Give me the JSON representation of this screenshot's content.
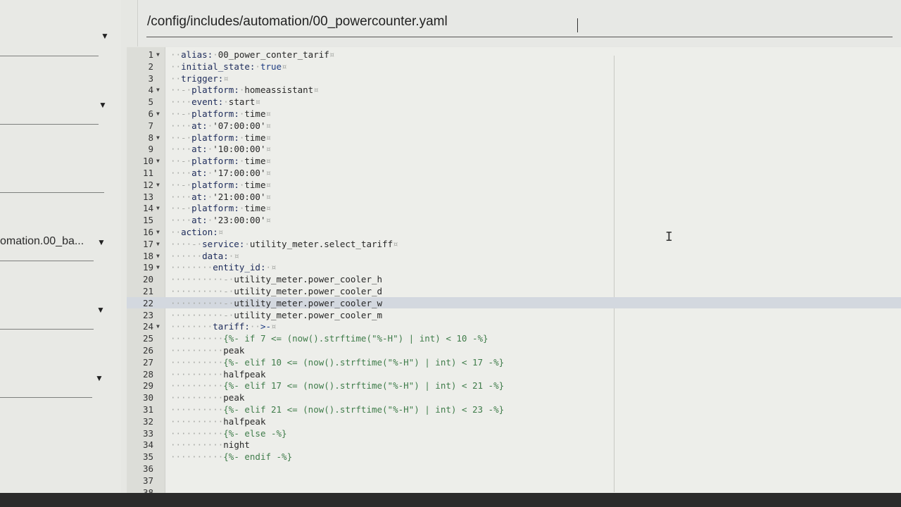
{
  "sidebar": {
    "visible_text": "omation.00_ba..."
  },
  "file_path": "/config/includes/automation/00_powercounter.yaml",
  "editor": {
    "active_line": 22,
    "lines": [
      {
        "n": "1",
        "fold": true,
        "indent": "··",
        "parts": [
          [
            "k",
            "alias:"
          ],
          [
            "ws",
            "·"
          ],
          [
            "v",
            "00_power_conter_tarif"
          ],
          [
            "ws",
            "¤"
          ]
        ]
      },
      {
        "n": "2",
        "fold": false,
        "indent": "··",
        "parts": [
          [
            "k",
            "initial_state:"
          ],
          [
            "ws",
            "·"
          ],
          [
            "b",
            "true"
          ],
          [
            "ws",
            "¤"
          ]
        ]
      },
      {
        "n": "3",
        "fold": false,
        "indent": "··",
        "parts": [
          [
            "k",
            "trigger:"
          ],
          [
            "ws",
            "¤"
          ]
        ]
      },
      {
        "n": "4",
        "fold": true,
        "indent": "··-·",
        "parts": [
          [
            "k",
            "platform:"
          ],
          [
            "ws",
            "·"
          ],
          [
            "v",
            "homeassistant"
          ],
          [
            "ws",
            "¤"
          ]
        ]
      },
      {
        "n": "5",
        "fold": false,
        "indent": "····",
        "parts": [
          [
            "k",
            "event:"
          ],
          [
            "ws",
            "·"
          ],
          [
            "v",
            "start"
          ],
          [
            "ws",
            "¤"
          ]
        ]
      },
      {
        "n": "6",
        "fold": true,
        "indent": "··-·",
        "parts": [
          [
            "k",
            "platform:"
          ],
          [
            "ws",
            "·"
          ],
          [
            "v",
            "time"
          ],
          [
            "ws",
            "¤"
          ]
        ]
      },
      {
        "n": "7",
        "fold": false,
        "indent": "····",
        "parts": [
          [
            "k",
            "at:"
          ],
          [
            "ws",
            "·"
          ],
          [
            "s",
            "'07:00:00'"
          ],
          [
            "ws",
            "¤"
          ]
        ]
      },
      {
        "n": "8",
        "fold": true,
        "indent": "··-·",
        "parts": [
          [
            "k",
            "platform:"
          ],
          [
            "ws",
            "·"
          ],
          [
            "v",
            "time"
          ],
          [
            "ws",
            "¤"
          ]
        ]
      },
      {
        "n": "9",
        "fold": false,
        "indent": "····",
        "parts": [
          [
            "k",
            "at:"
          ],
          [
            "ws",
            "·"
          ],
          [
            "s",
            "'10:00:00'"
          ],
          [
            "ws",
            "¤"
          ]
        ]
      },
      {
        "n": "10",
        "fold": true,
        "indent": "··-·",
        "parts": [
          [
            "k",
            "platform:"
          ],
          [
            "ws",
            "·"
          ],
          [
            "v",
            "time"
          ],
          [
            "ws",
            "¤"
          ]
        ]
      },
      {
        "n": "11",
        "fold": false,
        "indent": "····",
        "parts": [
          [
            "k",
            "at:"
          ],
          [
            "ws",
            "·"
          ],
          [
            "s",
            "'17:00:00'"
          ],
          [
            "ws",
            "¤"
          ]
        ]
      },
      {
        "n": "12",
        "fold": true,
        "indent": "··-·",
        "parts": [
          [
            "k",
            "platform:"
          ],
          [
            "ws",
            "·"
          ],
          [
            "v",
            "time"
          ],
          [
            "ws",
            "¤"
          ]
        ]
      },
      {
        "n": "13",
        "fold": false,
        "indent": "····",
        "parts": [
          [
            "k",
            "at:"
          ],
          [
            "ws",
            "·"
          ],
          [
            "s",
            "'21:00:00'"
          ],
          [
            "ws",
            "¤"
          ]
        ]
      },
      {
        "n": "14",
        "fold": true,
        "indent": "··-·",
        "parts": [
          [
            "k",
            "platform:"
          ],
          [
            "ws",
            "·"
          ],
          [
            "v",
            "time"
          ],
          [
            "ws",
            "¤"
          ]
        ]
      },
      {
        "n": "15",
        "fold": false,
        "indent": "····",
        "parts": [
          [
            "k",
            "at:"
          ],
          [
            "ws",
            "·"
          ],
          [
            "s",
            "'23:00:00'"
          ],
          [
            "ws",
            "¤"
          ]
        ]
      },
      {
        "n": "16",
        "fold": true,
        "indent": "··",
        "parts": [
          [
            "k",
            "action:"
          ],
          [
            "ws",
            "¤"
          ]
        ]
      },
      {
        "n": "17",
        "fold": true,
        "indent": "····-·",
        "parts": [
          [
            "k",
            "service:"
          ],
          [
            "ws",
            "·"
          ],
          [
            "v",
            "utility_meter.select_tariff"
          ],
          [
            "ws",
            "¤"
          ]
        ]
      },
      {
        "n": "18",
        "fold": true,
        "indent": "······",
        "parts": [
          [
            "k",
            "data:"
          ],
          [
            "ws",
            "·¤"
          ]
        ]
      },
      {
        "n": "19",
        "fold": true,
        "indent": "········",
        "parts": [
          [
            "k",
            "entity_id:"
          ],
          [
            "ws",
            "·¤"
          ]
        ]
      },
      {
        "n": "20",
        "fold": false,
        "indent": "··········-·",
        "parts": [
          [
            "v",
            "utility_meter.power_cooler_h"
          ]
        ]
      },
      {
        "n": "21",
        "fold": false,
        "indent": "··········-·",
        "parts": [
          [
            "v",
            "utility_meter.power_cooler_d"
          ]
        ]
      },
      {
        "n": "22",
        "fold": false,
        "indent": "··········-·",
        "parts": [
          [
            "v",
            "utility_meter.power_cooler_w"
          ]
        ]
      },
      {
        "n": "23",
        "fold": false,
        "indent": "··········-·",
        "parts": [
          [
            "v",
            "utility_meter.power_cooler_m"
          ]
        ]
      },
      {
        "n": "24",
        "fold": true,
        "indent": "········",
        "parts": [
          [
            "k",
            "tariff:"
          ],
          [
            "ws",
            "··"
          ],
          [
            "b",
            ">-"
          ],
          [
            "ws",
            "¤"
          ]
        ]
      },
      {
        "n": "25",
        "fold": false,
        "indent": "··········",
        "parts": [
          [
            "m",
            "{%- if 7 <= (now().strftime(\"%-H\") | int) < 10 -%}"
          ]
        ]
      },
      {
        "n": "26",
        "fold": false,
        "indent": "··········",
        "parts": [
          [
            "v",
            "peak"
          ]
        ]
      },
      {
        "n": "27",
        "fold": false,
        "indent": "··········",
        "parts": [
          [
            "m",
            "{%- elif 10 <= (now().strftime(\"%-H\") | int) < 17 -%}"
          ]
        ]
      },
      {
        "n": "28",
        "fold": false,
        "indent": "··········",
        "parts": [
          [
            "v",
            "halfpeak"
          ]
        ]
      },
      {
        "n": "29",
        "fold": false,
        "indent": "··········",
        "parts": [
          [
            "m",
            "{%- elif 17 <= (now().strftime(\"%-H\") | int) < 21 -%}"
          ]
        ]
      },
      {
        "n": "30",
        "fold": false,
        "indent": "··········",
        "parts": [
          [
            "v",
            "peak"
          ]
        ]
      },
      {
        "n": "31",
        "fold": false,
        "indent": "··········",
        "parts": [
          [
            "m",
            "{%- elif 21 <= (now().strftime(\"%-H\") | int) < 23 -%}"
          ]
        ]
      },
      {
        "n": "32",
        "fold": false,
        "indent": "··········",
        "parts": [
          [
            "v",
            "halfpeak"
          ]
        ]
      },
      {
        "n": "33",
        "fold": false,
        "indent": "··········",
        "parts": [
          [
            "m",
            "{%- else -%}"
          ]
        ]
      },
      {
        "n": "34",
        "fold": false,
        "indent": "··········",
        "parts": [
          [
            "v",
            "night"
          ]
        ]
      },
      {
        "n": "35",
        "fold": false,
        "indent": "··········",
        "parts": [
          [
            "m",
            "{%- endif -%}"
          ]
        ]
      },
      {
        "n": "36",
        "fold": false,
        "indent": "",
        "parts": []
      },
      {
        "n": "37",
        "fold": false,
        "indent": "",
        "parts": []
      },
      {
        "n": "38",
        "fold": false,
        "indent": "",
        "parts": []
      }
    ]
  }
}
